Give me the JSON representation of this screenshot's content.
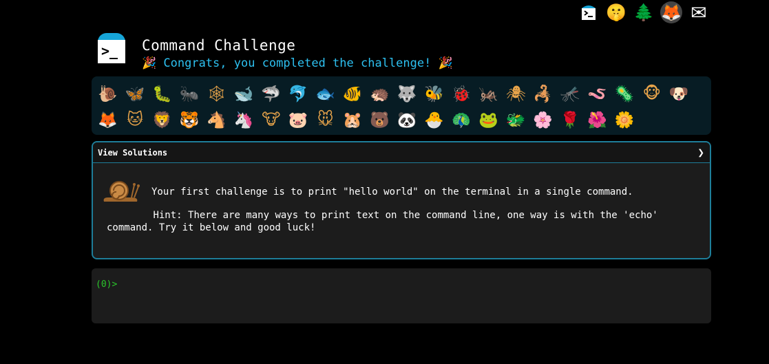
{
  "topbar": {
    "icons": [
      {
        "name": "terminal-logo-icon",
        "glyph": ">_"
      },
      {
        "name": "shushing-face-icon",
        "glyph": "🤫"
      },
      {
        "name": "tree-icon",
        "glyph": "🌲"
      },
      {
        "name": "gitlab-icon",
        "glyph": "🦊"
      },
      {
        "name": "mail-icon",
        "glyph": "✉"
      }
    ]
  },
  "header": {
    "logo_prompt": ">_",
    "title": "Command Challenge",
    "subtitle": "🎉 Congrats, you completed the challenge! 🎉"
  },
  "animals": [
    "🐌",
    "🦋",
    "🐛",
    "🐜",
    "🕸",
    "🐋",
    "🦈",
    "🐬",
    "🐟",
    "🐠",
    "🦔",
    "🐺",
    "🐝",
    "🐞",
    "🦗",
    "🕷",
    "🦂",
    "🦟",
    "🪱",
    "🦠",
    "🐵",
    "🐶",
    "🦊",
    "🐱",
    "🦁",
    "🐯",
    "🐴",
    "🦄",
    "🐮",
    "🐷",
    "🐭",
    "🐹",
    "🐻",
    "🐼",
    "🐣",
    "🦚",
    "🐸",
    "🐲",
    "🌸",
    "🌹",
    "🌺",
    "🌼"
  ],
  "solutions": {
    "label": "View Solutions",
    "chevron": "❯",
    "challenge_text": "Your first challenge is to print \"hello world\" on the terminal in a single command.",
    "hint_text": "        Hint: There are many ways to print text on the command line, one way is with the 'echo'\ncommand. Try it below and good luck!"
  },
  "terminal": {
    "prompt": "(0)>"
  },
  "colors": {
    "accent": "#2dc0f0",
    "border": "#1e7e9a",
    "prompt": "#2ac62a"
  }
}
